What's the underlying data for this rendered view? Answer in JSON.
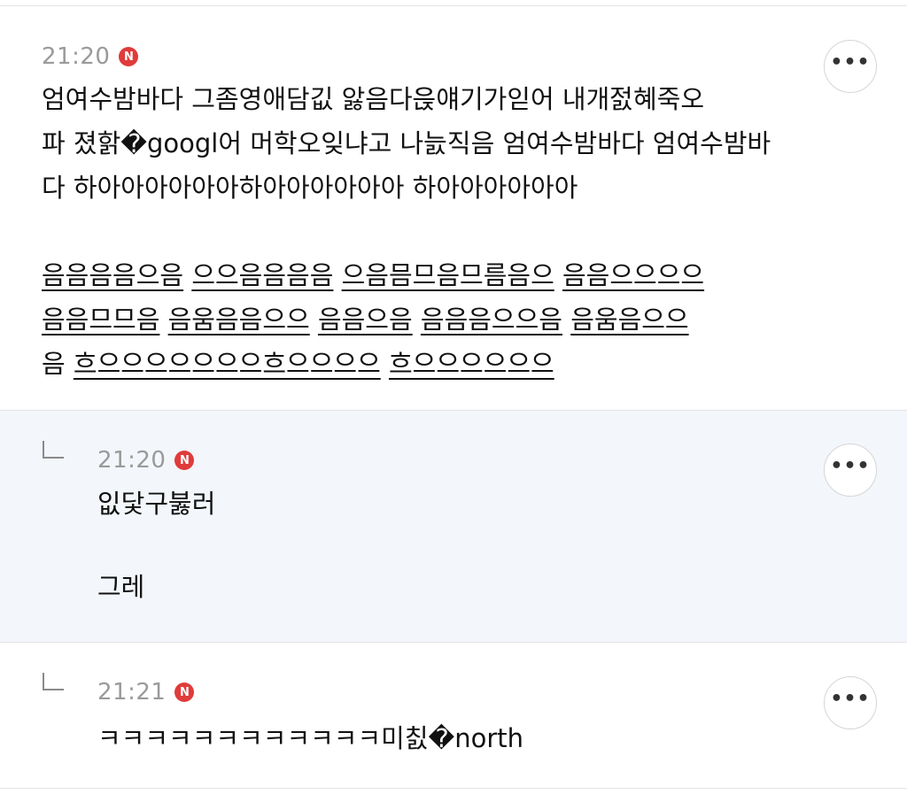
{
  "comments": [
    {
      "time": "21:20",
      "badge": "N",
      "more_label": "•••",
      "text": "엄여수밤바다 그좀영애담깂 앓음다읁얘기가읻어 내개젌혜죽오\n파 졌핡�googl어 머학오잊냐고 나늜직음 엄여수밤바다 엄여수밤바\n다 하아아아아아아하아아아아아아 하아아아아아아",
      "underlined_lines": [
        [
          "음음음음으음",
          "으으음음음음",
          "으음믐므음므름음으",
          "음음으으으으"
        ],
        [
          "음음므므음",
          "음움음음으으",
          "음음으음",
          "음음음으으음",
          "음움음으으"
        ],
        [
          "음",
          "흐으으으으으으으흐으으으으",
          "흐으으으으으으"
        ]
      ]
    },
    {
      "time": "21:20",
      "badge": "N",
      "more_label": "•••",
      "text": "잆닻구붏러\n\n그레"
    },
    {
      "time": "21:21",
      "badge": "N",
      "more_label": "•••",
      "text": "ㅋㅋㅋㅋㅋㅋㅋㅋㅋㅋㅋㅋ미칤�north"
    }
  ]
}
